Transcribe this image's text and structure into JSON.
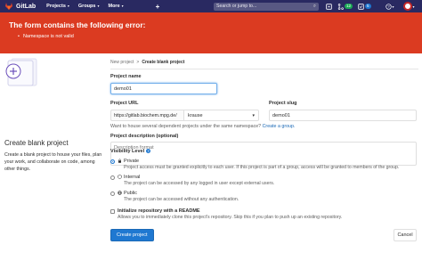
{
  "navbar": {
    "logo_text": "GitLab",
    "menu": [
      {
        "label": "Projects"
      },
      {
        "label": "Groups"
      },
      {
        "label": "More"
      }
    ],
    "plus": "+",
    "search_placeholder": "Search or jump to...",
    "badges": {
      "merge_requests": "12",
      "todos": "5"
    },
    "colors": {
      "navbar": "#292961",
      "error": "#db3b21",
      "primary": "#1f78d1"
    }
  },
  "error": {
    "title": "The form contains the following error:",
    "items": [
      "Namespace is not valid"
    ]
  },
  "left": {
    "title": "Create blank project",
    "description": "Create a blank project to house your files, plan your work, and collaborate on code, among other things."
  },
  "breadcrumb": {
    "parent": "New project",
    "separator": ">",
    "current": "Create blank project"
  },
  "form": {
    "project_name_label": "Project name",
    "project_name_value": "demo01",
    "project_url_label": "Project URL",
    "url_prefix": "https://gitlab.biochem.mpg.de/",
    "namespace_value": "krause",
    "slug_label": "Project slug",
    "slug_value": "demo01",
    "group_help_text": "Want to house several dependent projects under the same namespace?",
    "group_help_link": "Create a group.",
    "description_label": "Project description (optional)",
    "description_placeholder": "Description format",
    "visibility_label": "Visibility Level",
    "visibility_help_icon": "?",
    "visibility": [
      {
        "title": "Private",
        "desc": "Project access must be granted explicitly to each user. If this project is part of a group, access will be granted to members of the group.",
        "checked": true,
        "icon": "lock-icon"
      },
      {
        "title": "Internal",
        "desc": "The project can be accessed by any logged in user except external users.",
        "checked": false,
        "icon": "shield-icon"
      },
      {
        "title": "Public",
        "desc": "The project can be accessed without any authentication.",
        "checked": false,
        "icon": "globe-icon"
      }
    ],
    "readme_title": "Initialize repository with a README",
    "readme_desc": "Allows you to immediately clone this project's repository. Skip this if you plan to push up an existing repository.",
    "create_button": "Create project",
    "cancel_button": "Cancel"
  }
}
